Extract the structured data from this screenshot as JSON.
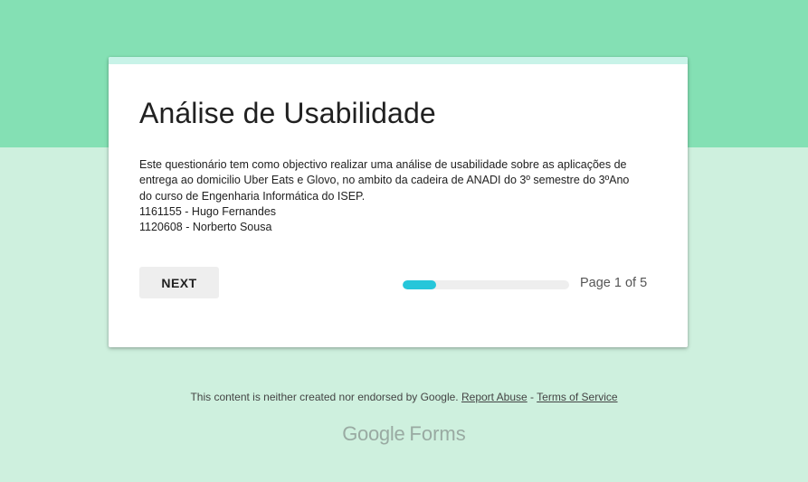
{
  "colors": {
    "header_band": "#84e0b4",
    "page_background": "#cef0de",
    "card_strip": "#c8f3e8",
    "progress_fill": "#26c6da",
    "progress_track": "#eeeeee"
  },
  "form": {
    "title": "Análise de Usabilidade",
    "description_lines": [
      "Este questionário tem como objectivo realizar uma análise de usabilidade sobre as aplicações de",
      "entrega ao domicilio Uber Eats e Glovo, no ambito da cadeira de ANADI do 3º semestre do 3ºAno",
      "do curso de Engenharia Informática do ISEP.",
      "1161155 - Hugo Fernandes",
      "1120608 - Norberto Sousa"
    ]
  },
  "navigation": {
    "next_label": "NEXT",
    "progress_fraction": 0.2,
    "page_label": "Page 1 of 5"
  },
  "footer": {
    "disclaimer": "This content is neither created nor endorsed by Google.",
    "report_abuse": "Report Abuse",
    "separator": "-",
    "terms": "Terms of Service",
    "brand_google": "Google",
    "brand_forms": "Forms"
  }
}
